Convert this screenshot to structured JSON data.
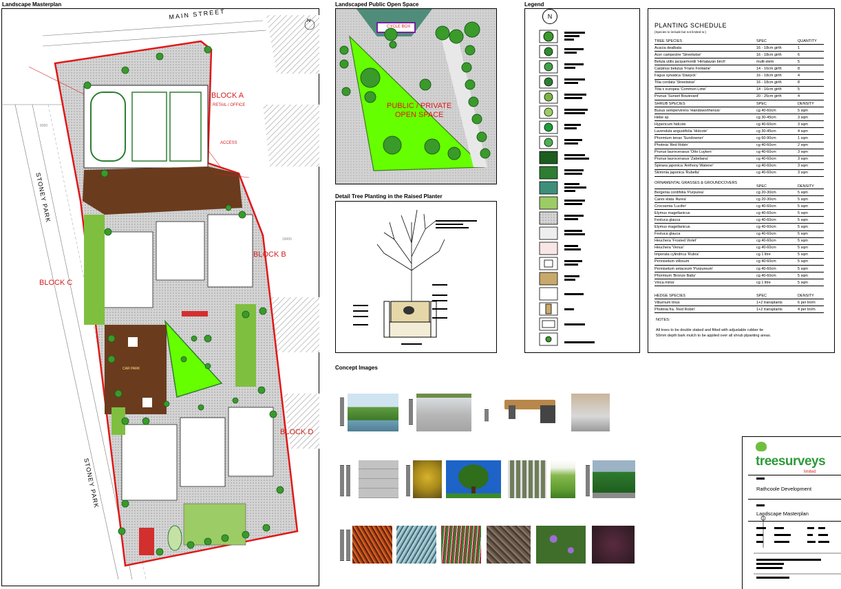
{
  "panels": {
    "masterplan_title": "Landscape Masterplan",
    "open_space_title": "Landscaped Public Open Space",
    "detail_title": "Detail Tree Planting in the Raised Planter",
    "legend_title": "Legend",
    "concept_title": "Concept Images"
  },
  "plan_labels": {
    "main_street": "MAIN STREET",
    "stoney_park_1": "STONEY PARK",
    "stoney_park_2": "STONEY PARK",
    "block_a": "BLOCK A",
    "block_a_sub": "RETAIL / OFFICE",
    "block_b": "BLOCK B",
    "block_c": "BLOCK C",
    "block_d": "BLOCK D",
    "access": "ACCESS",
    "open_space_label_line1": "PUBLIC / PRIVATE",
    "open_space_label_line2": "OPEN SPACE",
    "car_park": "CAR PARK",
    "cycle_box": "CYCLE BOX",
    "dim_1": "18450",
    "dim_2": "6000"
  },
  "schedule": {
    "title": "PLANTING SCHEDULE",
    "subtitle": "(Species to include but not limited to:)",
    "trees_header": [
      "TREE SPECIES",
      "SPEC",
      "QUANTITY"
    ],
    "trees": [
      [
        "Acacia dealbata",
        "16 - 18cm girth",
        "1"
      ],
      [
        "Acer campestre 'Streetwise'",
        "16 - 18cm girth",
        "6"
      ],
      [
        "Betula utilis jacquemontii 'Himalayan birch'",
        "multi-stem",
        "5"
      ],
      [
        "Carpinus betulus 'Frans Fontaine'",
        "14 - 16cm girth",
        "8"
      ],
      [
        "Fagus sylvatica 'Dawyck'",
        "16 - 18cm girth",
        "4"
      ],
      [
        "Tilia cordata 'Streetwise'",
        "16 - 18cm girth",
        "8"
      ],
      [
        "Tilia x europea 'Common Lime'",
        "14 - 16cm girth",
        "5"
      ],
      [
        "Prunus 'Sunset Boulevard'",
        "20 - 25cm girth",
        "4"
      ]
    ],
    "shrubs_header": [
      "SHRUB SPECIES",
      "SPEC",
      "DENSITY"
    ],
    "shrubs": [
      [
        "Buxus sempervirens 'Handsworthensis'",
        "cg 40-60cm",
        "5 sqm"
      ],
      [
        "Hebe sp",
        "cg 30-45cm",
        "3 sqm"
      ],
      [
        "Hypericum hidcote",
        "cg 40-60cm",
        "3 sqm"
      ],
      [
        "Lavendula angustifolia 'Hidcote'",
        "cg 30-45cm",
        "4 sqm"
      ],
      [
        "Phormium tenax 'Sundowner'",
        "cg 60-90cm",
        "1 sqm"
      ],
      [
        "Photinia 'Red Robin'",
        "cg 40-60cm",
        "2 sqm"
      ],
      [
        "Prunus laurocerasus 'Otto Luyken'",
        "cg 40-60cm",
        "3 sqm"
      ],
      [
        "Prunus laurocerasus 'Zabeliana'",
        "cg 40-60cm",
        "3 sqm"
      ],
      [
        "Spiraea japonica 'Anthony Waterer'",
        "cg 40-60cm",
        "3 sqm"
      ],
      [
        "Skimmia japonica 'Rubella'",
        "cg 40-60cm",
        "3 sqm"
      ]
    ],
    "grasses_header": [
      "ORNAMENTAL GRASSES & GROUNDCOVERS",
      "SPEC",
      "DENSITY"
    ],
    "grasses": [
      [
        "Bergenia cordifolia 'Purpurea'",
        "cg 20-30cm",
        "5 sqm"
      ],
      [
        "Carex elata 'Aurea'",
        "cg 20-30cm",
        "5 sqm"
      ],
      [
        "Crocosmia 'Lucifer'",
        "cg 40-60cm",
        "5 sqm"
      ],
      [
        "Elymus magellanicus",
        "cg 40-60cm",
        "5 sqm"
      ],
      [
        "Festuca glauca",
        "cg 40-60cm",
        "5 sqm"
      ],
      [
        "Elymus magellanicus",
        "cg 40-60cm",
        "5 sqm"
      ],
      [
        "Festuca glauca",
        "cg 40-60cm",
        "5 sqm"
      ],
      [
        "Heuchera 'Frosted Violet'",
        "cg 40-60cm",
        "5 sqm"
      ],
      [
        "Heuchera 'Venus'",
        "cg 40-60cm",
        "5 sqm"
      ],
      [
        "Imperata cylindrica 'Rubra'",
        "cg 1 litre",
        "5 sqm"
      ],
      [
        "Pennisetum villosum",
        "cg 40-60cm",
        "5 sqm"
      ],
      [
        "Pennisetum setaceum 'Purpureum'",
        "cg 40-60cm",
        "5 sqm"
      ],
      [
        "Phormium 'Bronze Baby'",
        "cg 40-60cm",
        "5 sqm"
      ],
      [
        "Vinca minor",
        "cg 1 litre",
        "5 sqm"
      ]
    ],
    "hedge_header": [
      "HEDGE SPECIES",
      "SPEC",
      "DENSITY"
    ],
    "hedges": [
      [
        "Viburnum tinus",
        "1+2 transplants",
        "6 per lin/m"
      ],
      [
        "Photinia fra. 'Red Robin'",
        "1+2 transplants",
        "4 per lin/m"
      ]
    ],
    "notes_title": "NOTES:",
    "notes": [
      "All trees to be double staked and fitted with adjustable rubber tie",
      "50mm depth bark mulch to be applied over all shrub plpanting areas."
    ]
  },
  "title_block": {
    "logo_text": "treesurveys",
    "logo_sub": "limited",
    "project": "Rathcoole Development",
    "drawing": "Landscape Masterplan"
  },
  "colors": {
    "site_boundary": "#e01818",
    "grass": "#7fbf3f",
    "bright_grass": "#66ff00",
    "paving": "#c8c8c8",
    "brown": "#6b3b1e",
    "brand_green": "#2e9a3a"
  }
}
